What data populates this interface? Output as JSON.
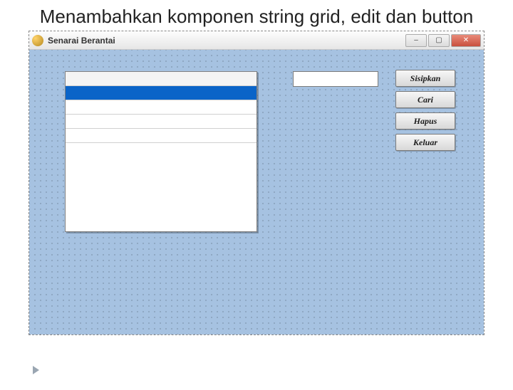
{
  "slide": {
    "title": "Menambahkan komponen string grid, edit dan button"
  },
  "window": {
    "title": "Senarai Berantai",
    "controls": {
      "minimize": "–",
      "maximize": "▢",
      "close": "✕"
    }
  },
  "form": {
    "edit": {
      "value": ""
    },
    "buttons": {
      "sisipkan": "Sisipkan",
      "cari": "Cari",
      "hapus": "Hapus",
      "keluar": "Keluar"
    },
    "grid": {
      "rows": [
        "",
        "",
        "",
        "",
        ""
      ]
    }
  }
}
